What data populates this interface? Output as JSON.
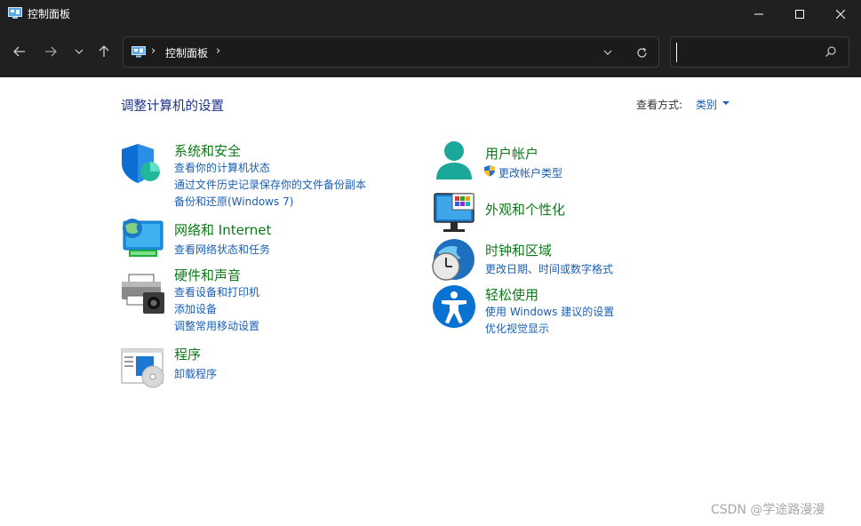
{
  "window": {
    "title": "控制面板",
    "address_crumb": "控制面板",
    "search_placeholder": "",
    "title_icon": "control-panel-icon"
  },
  "nav": {
    "buttons": [
      "back-arrow-icon",
      "forward-arrow-icon",
      "chevron-down-icon",
      "up-arrow-icon"
    ]
  },
  "header": {
    "heading": "调整计算机的设置",
    "view_by_label": "查看方式:",
    "view_by_value": "类别"
  },
  "categories_left": [
    {
      "title": "系统和安全",
      "links": [
        "查看你的计算机状态",
        "通过文件历史记录保存你的文件备份副本",
        "备份和还原(Windows 7)"
      ]
    },
    {
      "title": "网络和 Internet",
      "links": [
        "查看网络状态和任务"
      ]
    },
    {
      "title": "硬件和声音",
      "links": [
        "查看设备和打印机",
        "添加设备",
        "调整常用移动设置"
      ]
    },
    {
      "title": "程序",
      "links": [
        "卸载程序"
      ]
    }
  ],
  "categories_right": [
    {
      "title": "用户帐户",
      "links": [
        "更改帐户类型"
      ]
    },
    {
      "title": "外观和个性化",
      "links": []
    },
    {
      "title": "时钟和区域",
      "links": [
        "更改日期、时间或数字格式"
      ]
    },
    {
      "title": "轻松使用",
      "links": [
        "使用 Windows 建议的设置",
        "优化视觉显示"
      ]
    }
  ],
  "watermark": "CSDN @学途路漫漫",
  "colors": {
    "titlebar_bg": "#202020",
    "category_title": "#0d7a18",
    "link": "#1a5fb4",
    "heading": "#1e3287"
  }
}
